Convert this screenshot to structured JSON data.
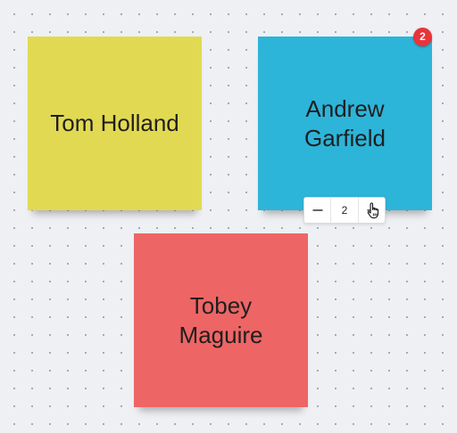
{
  "board": {
    "notes": [
      {
        "text": "Tom Holland",
        "color": "#e2d952"
      },
      {
        "text": "Andrew\nGarfield",
        "color": "#2db4d9",
        "votes": "2",
        "badge_color": "#e8343a"
      },
      {
        "text": "Tobey\nMaguire",
        "color": "#ee6565"
      }
    ]
  },
  "vote_control": {
    "count": "2",
    "minus_icon": "minus-icon",
    "plus_icon": "plus-icon"
  },
  "icons": {
    "cursor": "hand-pointer-cursor-icon"
  }
}
